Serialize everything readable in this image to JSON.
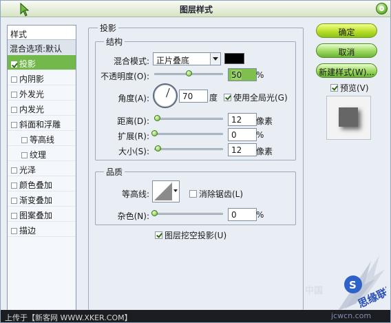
{
  "window": {
    "title": "图层样式"
  },
  "styles_list": {
    "header": "样式",
    "items": [
      {
        "label": "混合选项:默认",
        "checkbox": false,
        "checked": false,
        "selected": false
      },
      {
        "label": "投影",
        "checkbox": true,
        "checked": true,
        "selected": true
      },
      {
        "label": "内阴影",
        "checkbox": true,
        "checked": false,
        "selected": false
      },
      {
        "label": "外发光",
        "checkbox": true,
        "checked": false,
        "selected": false
      },
      {
        "label": "内发光",
        "checkbox": true,
        "checked": false,
        "selected": false
      },
      {
        "label": "斜面和浮雕",
        "checkbox": true,
        "checked": false,
        "selected": false
      },
      {
        "label": "等高线",
        "checkbox": true,
        "checked": false,
        "selected": false
      },
      {
        "label": "纹理",
        "checkbox": true,
        "checked": false,
        "selected": false
      },
      {
        "label": "光泽",
        "checkbox": true,
        "checked": false,
        "selected": false
      },
      {
        "label": "颜色叠加",
        "checkbox": true,
        "checked": false,
        "selected": false
      },
      {
        "label": "渐变叠加",
        "checkbox": true,
        "checked": false,
        "selected": false
      },
      {
        "label": "图案叠加",
        "checkbox": true,
        "checked": false,
        "selected": false
      },
      {
        "label": "描边",
        "checkbox": true,
        "checked": false,
        "selected": false
      }
    ]
  },
  "drop_shadow": {
    "group_title": "投影",
    "structure": {
      "title": "结构",
      "blend_mode_label": "混合模式:",
      "blend_mode_value": "正片叠底",
      "shadow_color": "#000000",
      "opacity_label": "不透明度(O):",
      "opacity_value": "50",
      "opacity_percent": 0.5,
      "opacity_unit": "%",
      "angle_label": "角度(A):",
      "angle_value": "70",
      "angle_unit": "度",
      "global_light_label": "使用全局光(G)",
      "global_light_checked": true,
      "distance_label": "距离(D):",
      "distance_value": "12",
      "distance_fraction": 0.04,
      "distance_unit": "像素",
      "spread_label": "扩展(R):",
      "spread_value": "0",
      "spread_fraction": 0.0,
      "spread_unit": "%",
      "size_label": "大小(S):",
      "size_value": "12",
      "size_fraction": 0.05,
      "size_unit": "像素"
    },
    "quality": {
      "title": "品质",
      "contour_label": "等高线:",
      "anti_alias_label": "消除锯齿(L)",
      "anti_alias_checked": false,
      "noise_label": "杂色(N):",
      "noise_value": "0",
      "noise_fraction": 0.0,
      "noise_unit": "%"
    },
    "knockout_label": "图层挖空投影(U)",
    "knockout_checked": true
  },
  "buttons": {
    "ok": "确定",
    "cancel": "取消",
    "new_style": "新建样式(W)...",
    "preview_label": "预览(V)",
    "preview_checked": true
  },
  "watermark": {
    "footer_text": "上传于【新客网 WWW.XKER.COM】",
    "site_url": "jcwcn.com",
    "cn_mark": "中国"
  },
  "colors": {
    "accent_green": "#73b84a",
    "window_bg": "#e9eef4"
  }
}
